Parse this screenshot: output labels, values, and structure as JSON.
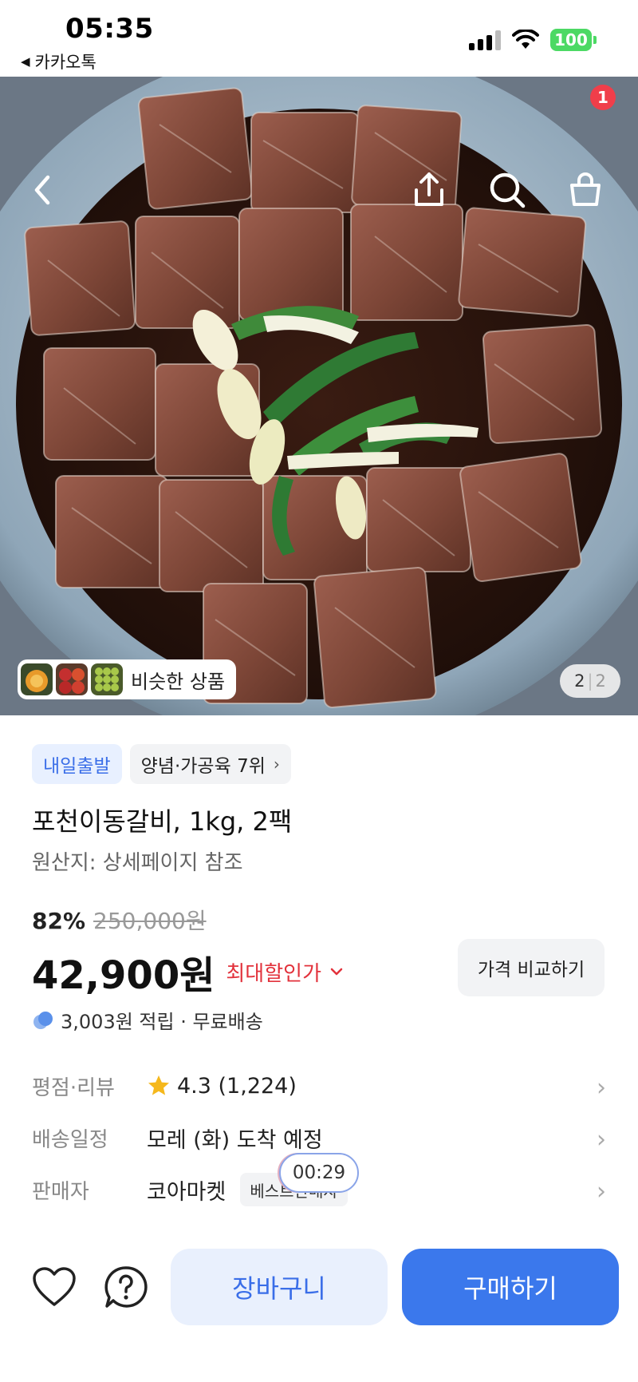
{
  "status_bar": {
    "time": "05:35",
    "back_app": "카카오톡",
    "battery": "100"
  },
  "hero": {
    "image_icon": "marinated-galbi-photo",
    "cart_badge": "1",
    "similar_products_label": "비슷한 상품",
    "page_current": "2",
    "page_separator": "|",
    "page_total": "2"
  },
  "product": {
    "tag_delivery": "내일출발",
    "tag_rank": "양념·가공육 7위",
    "title": "포천이동갈비, 1kg, 2팩",
    "origin": "원산지: 상세페이지 참조",
    "discount": "82%",
    "original_price": "250,000원",
    "price": "42,900원",
    "max_discount_label": "최대할인가",
    "compare_button": "가격 비교하기",
    "points": "3,003원 적립 · 무료배송"
  },
  "info": {
    "rating_label": "평점·리뷰",
    "rating_value": "4.3 (1,224)",
    "delivery_label": "배송일정",
    "delivery_value": "모레 (화) 도착 예정",
    "seller_label": "판매자",
    "seller_value": "코아마켓",
    "seller_badge": "베스트판매자",
    "timer": "00:29"
  },
  "actions": {
    "cart_button": "장바구니",
    "buy_button": "구매하기"
  },
  "colors": {
    "accent": "#3b78ec",
    "discount_red": "#e2323c",
    "badge_red": "#f03e4a"
  }
}
